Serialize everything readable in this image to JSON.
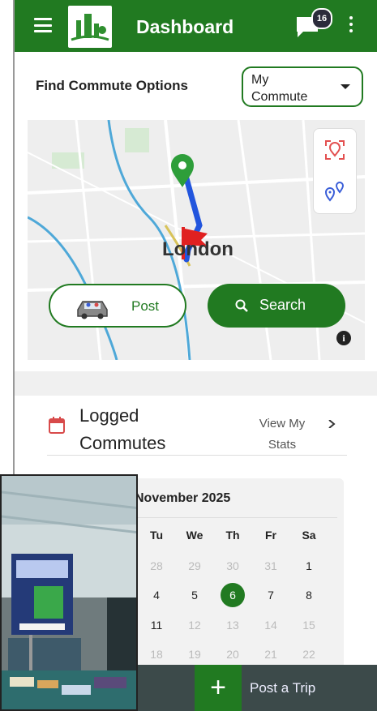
{
  "header": {
    "title": "Dashboard",
    "notification_count": "16"
  },
  "commute": {
    "find_label": "Find Commute Options",
    "selector_value": "My Commute",
    "map_city_label": "London",
    "post_label": "Post",
    "search_label": "Search"
  },
  "logged": {
    "title": "Logged Commutes",
    "view_stats_label": "View My Stats"
  },
  "calendar": {
    "month_label": "November 2025",
    "weekdays": [
      "Tu",
      "We",
      "Th",
      "Fr",
      "Sa"
    ],
    "rows": [
      [
        "28",
        "29",
        "30",
        "31",
        "1"
      ],
      [
        "4",
        "5",
        "6",
        "7",
        "8"
      ],
      [
        "11",
        "12",
        "13",
        "14",
        "15"
      ],
      [
        "18",
        "19",
        "20",
        "21",
        "22"
      ]
    ],
    "selected_day": "6"
  },
  "bottom": {
    "post_trip_label": "Post a Trip",
    "plus_glyph": "+"
  },
  "colors": {
    "brand_green": "#217a21",
    "route_blue": "#2255dd",
    "flag_red": "#e02020"
  },
  "icons": [
    "menu-icon",
    "logo",
    "chat-icon",
    "more-vert-icon",
    "locate-icon",
    "route-icon",
    "car-icon",
    "search-icon",
    "info-icon",
    "calendar-icon",
    "chevron-right-icon",
    "plus-icon"
  ]
}
